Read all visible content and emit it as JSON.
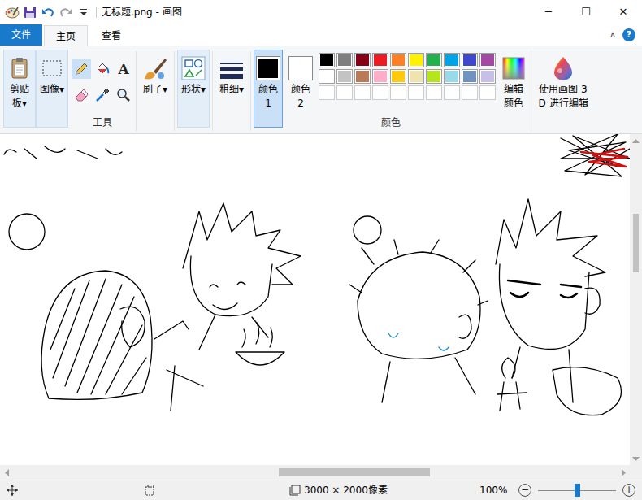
{
  "window": {
    "title": "无标题.png - 画图",
    "controls": [
      {
        "glyph": "─",
        "kind": "minimize"
      },
      {
        "glyph": "☐",
        "kind": "maximize"
      },
      {
        "glyph": "✕",
        "kind": "close"
      }
    ]
  },
  "menu_tabs": [
    {
      "label": "文件",
      "kind": "file",
      "selected": false
    },
    {
      "label": "主页",
      "kind": "tab",
      "selected": true
    },
    {
      "label": "查看",
      "kind": "tab",
      "selected": false
    }
  ],
  "ribbon_controls": {
    "collapse": "∧",
    "help": "?"
  },
  "dropdown_glyph": "▾",
  "ribbon": {
    "clipboard": {
      "label": "剪贴板",
      "highlighted": true
    },
    "image": {
      "label": "图像",
      "highlighted": true
    },
    "tools": {
      "label": "工具",
      "items": [
        {
          "kind": "pencil",
          "selected": true
        },
        {
          "kind": "fill",
          "selected": false
        },
        {
          "kind": "text",
          "glyph": "A",
          "selected": false
        },
        {
          "kind": "eraser",
          "selected": false
        },
        {
          "kind": "picker",
          "selected": false
        },
        {
          "kind": "magnifier",
          "selected": false
        }
      ]
    },
    "brushes": {
      "label": "刷子",
      "highlighted": false
    },
    "shapes": {
      "label": "形状",
      "highlighted": true
    },
    "size": {
      "label": "粗细",
      "highlighted": false
    },
    "colors": {
      "label": "颜色",
      "color1": {
        "label": "颜色 1",
        "color": "#000000",
        "selected": true
      },
      "color2": {
        "label": "颜色 2",
        "color": "#ffffff",
        "selected": false
      },
      "palette": [
        {
          "color": "#000000"
        },
        {
          "color": "#7f7f7f"
        },
        {
          "color": "#880015"
        },
        {
          "color": "#ed1c24"
        },
        {
          "color": "#ff7f27"
        },
        {
          "color": "#fff200"
        },
        {
          "color": "#22b14c"
        },
        {
          "color": "#00a2e8"
        },
        {
          "color": "#3f48cc"
        },
        {
          "color": "#a349a4"
        },
        {
          "color": "#ffffff"
        },
        {
          "color": "#c3c3c3"
        },
        {
          "color": "#b97a57"
        },
        {
          "color": "#ffaec9"
        },
        {
          "color": "#ffc90e"
        },
        {
          "color": "#efe4b0"
        },
        {
          "color": "#b5e61d"
        },
        {
          "color": "#99d9ea"
        },
        {
          "color": "#7092be"
        },
        {
          "color": "#c8bfe7"
        }
      ],
      "edit": {
        "label": "编辑颜色"
      }
    },
    "paint3d": {
      "label": "使用画图 3 D 进行编辑"
    }
  },
  "canvas": {
    "vertical_scroll": {
      "position": 0.22,
      "size": 0.19
    },
    "horizontal_scroll": {
      "position": 0.44,
      "size": 0.25
    }
  },
  "status_bar": {
    "canvas_size": "3000 × 2000像素",
    "zoom": "100%",
    "zoom_level": 0.5,
    "zoom_out": "−",
    "zoom_in": "+"
  }
}
